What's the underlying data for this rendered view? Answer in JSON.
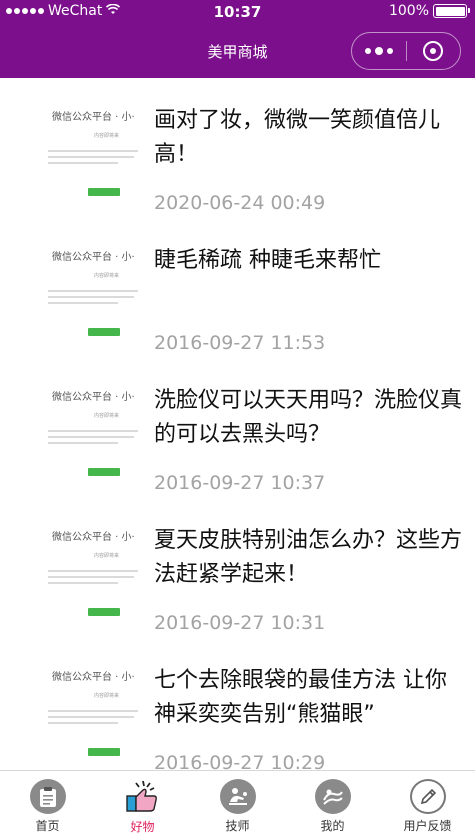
{
  "status_bar": {
    "carrier": "WeChat",
    "time": "10:37",
    "battery": "100%"
  },
  "nav": {
    "title": "美甲商城"
  },
  "thumbnail": {
    "title": "微信公众平台 · 小·",
    "subtitle": "内容即将来"
  },
  "articles": [
    {
      "title": "画对了妆，微微一笑颜值倍儿高！",
      "date": "2020-06-24 00:49"
    },
    {
      "title": "睫毛稀疏 种睫毛来帮忙",
      "date": "2016-09-27 11:53"
    },
    {
      "title": "洗脸仪可以天天用吗？洗脸仪真的可以去黑头吗？",
      "date": "2016-09-27 10:37"
    },
    {
      "title": "夏天皮肤特别油怎么办？这些方法赶紧学起来！",
      "date": "2016-09-27 10:31"
    },
    {
      "title": "七个去除眼袋的最佳方法 让你神采奕奕告别“熊猫眼”",
      "date": "2016-09-27 10:29"
    }
  ],
  "tabs": [
    {
      "label": "首页",
      "icon": "clipboard-icon"
    },
    {
      "label": "好物",
      "icon": "thumbs-up-icon",
      "active": true
    },
    {
      "label": "技师",
      "icon": "technician-icon"
    },
    {
      "label": "我的",
      "icon": "profile-icon"
    },
    {
      "label": "用户反馈",
      "icon": "pen-icon"
    }
  ],
  "colors": {
    "brand": "#7c0f8c",
    "active_tab": "#e0245e",
    "date_text": "#a3a3a3",
    "thumb_button": "#45b64a"
  }
}
